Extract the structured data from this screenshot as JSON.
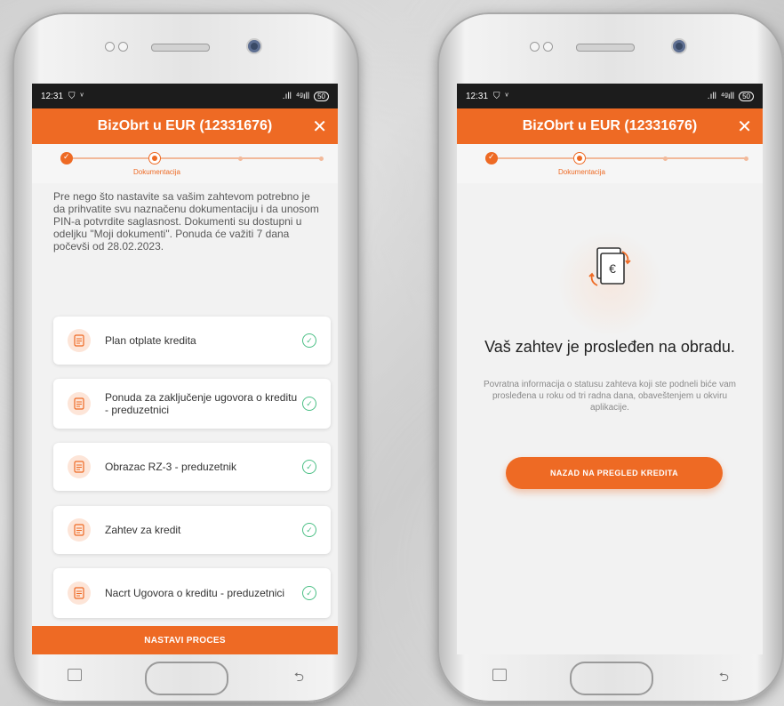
{
  "status_bar": {
    "time": "12:31",
    "signal": ".ıll",
    "network": "⁴ᵍıll",
    "battery": "50"
  },
  "app_bar": {
    "title": "BizObrt u EUR (12331676)",
    "close_icon": "close-icon"
  },
  "stepper": {
    "active_label": "Dokumentacija"
  },
  "left_screen": {
    "intro_text": "Pre nego što nastavite sa vašim zahtevom potrebno je da prihvatite svu naznačenu dokumentaciju i da unosom PIN-a potvrdite saglasnost. Dokumenti su dostupni u odeljku \"Moji dokumenti\". Ponuda će važiti 7 dana počevši od 28.02.2023.",
    "documents": [
      {
        "label": "Plan otplate kredita"
      },
      {
        "label": "Ponuda za zaključenje ugovora o kreditu - preduzetnici"
      },
      {
        "label": "Obrazac RZ-3 - preduzetnik"
      },
      {
        "label": "Zahtev za kredit"
      },
      {
        "label": "Nacrt Ugovora o kreditu - preduzetnici"
      }
    ],
    "continue_button": "NASTAVI PROCES"
  },
  "right_screen": {
    "title": "Vaš zahtev je prosleđen na obradu.",
    "subtitle": "Povratna informacija o statusu zahteva koji ste podneli biće vam prosleđena u roku od tri radna dana, obaveštenjem u okviru aplikacije.",
    "back_button": "NAZAD NA PREGLED KREDITA"
  },
  "colors": {
    "accent": "#ee6a24",
    "success": "#4bbf85"
  }
}
